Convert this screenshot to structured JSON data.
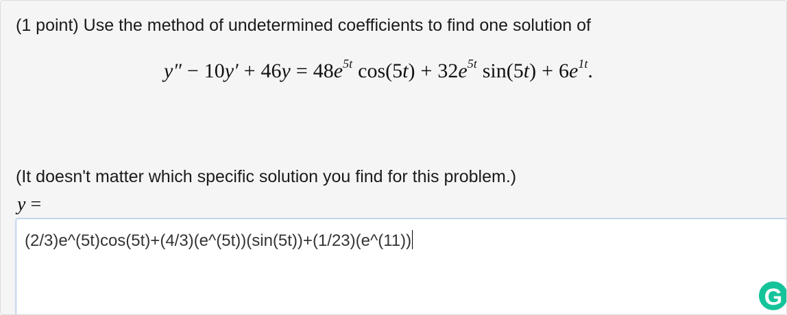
{
  "problem": {
    "prompt": "(1 point) Use the method of undetermined coefficients to find one solution of",
    "equation": {
      "lhs_y2": "y″",
      "minus": "−",
      "coef1": "10",
      "lhs_y1": "y′",
      "plus1": "+",
      "coef2": "46",
      "lhs_y0": "y",
      "equals": "=",
      "rhs_coef1": "48",
      "e1": "e",
      "exp1": "5t",
      "func1": "cos(5",
      "t1": "t",
      "close1": ")",
      "plus2": "+",
      "rhs_coef2": "32",
      "e2": "e",
      "exp2": "5t",
      "func2": "sin(5",
      "t2": "t",
      "close2": ")",
      "plus3": "+",
      "rhs_coef3": "6",
      "e3": "e",
      "exp3": "1t",
      "period": "."
    },
    "note": "(It doesn't matter which specific solution you find for this problem.)"
  },
  "answer": {
    "label_var": "y",
    "label_equals": "=",
    "value": "(2/3)e^(5t)cos(5t)+(4/3)(e^(5t))(sin(5t))+(1/23)(e^(11))"
  },
  "grammarly": {
    "letter": "G",
    "color": "#15c39a"
  }
}
